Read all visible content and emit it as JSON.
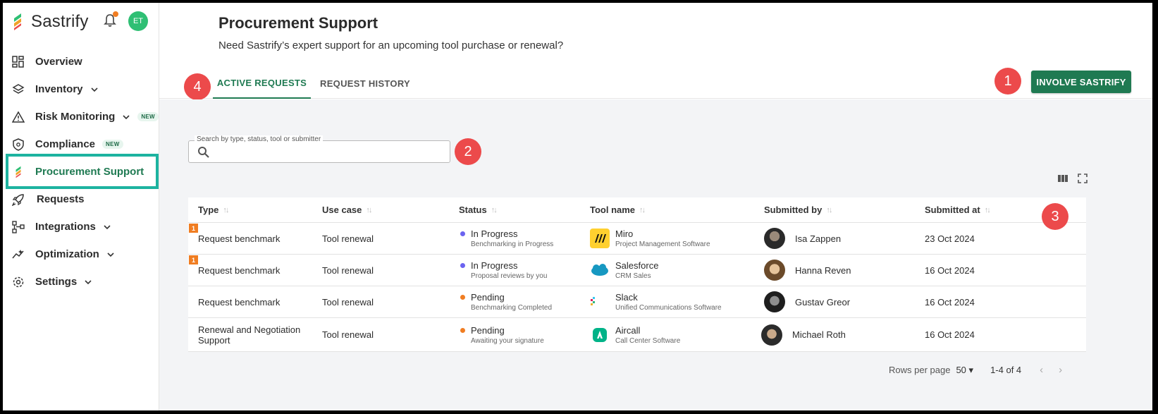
{
  "app": {
    "brand": "Sastrify",
    "user_initials": "ET"
  },
  "sidebar": {
    "items": [
      {
        "label": "Overview"
      },
      {
        "label": "Inventory"
      },
      {
        "label": "Risk Monitoring",
        "badge": "NEW"
      },
      {
        "label": "Compliance",
        "badge": "NEW"
      },
      {
        "label": "Procurement Support"
      },
      {
        "label": "Requests"
      },
      {
        "label": "Integrations"
      },
      {
        "label": "Optimization"
      },
      {
        "label": "Settings"
      }
    ]
  },
  "header": {
    "title": "Procurement Support",
    "subtitle": "Need Sastrify’s expert support for an upcoming tool purchase or renewal?"
  },
  "tabs": [
    {
      "label": "ACTIVE REQUESTS"
    },
    {
      "label": "REQUEST HISTORY"
    }
  ],
  "actions": {
    "involve_label": "INVOLVE SASTRIFY"
  },
  "markers": {
    "m1": "1",
    "m2": "2",
    "m3": "3",
    "m4": "4"
  },
  "search": {
    "label": "Search by type, status, tool or submitter",
    "value": ""
  },
  "table": {
    "headers": {
      "type": "Type",
      "use_case": "Use case",
      "status": "Status",
      "tool": "Tool name",
      "submitted_by": "Submitted by",
      "submitted_at": "Submitted at"
    },
    "rows": [
      {
        "flag": "1",
        "type": "Request benchmark",
        "use_case": "Tool renewal",
        "status": "In Progress",
        "status_sub": "Benchmarking in Progress",
        "tool": "Miro",
        "tool_cat": "Project Management Software",
        "submitter": "Isa Zappen",
        "date": "23 Oct 2024"
      },
      {
        "flag": "1",
        "type": "Request benchmark",
        "use_case": "Tool renewal",
        "status": "In Progress",
        "status_sub": "Proposal reviews by you",
        "tool": "Salesforce",
        "tool_cat": "CRM Sales",
        "submitter": "Hanna Reven",
        "date": "16 Oct 2024"
      },
      {
        "type": "Request benchmark",
        "use_case": "Tool renewal",
        "status": "Pending",
        "status_sub": "Benchmarking Completed",
        "tool": "Slack",
        "tool_cat": "Unified Communications Software",
        "submitter": "Gustav Greor",
        "date": "16 Oct 2024"
      },
      {
        "type": "Renewal and Negotiation Support",
        "use_case": "Tool renewal",
        "status": "Pending",
        "status_sub": "Awaiting your signature",
        "tool": "Aircall",
        "tool_cat": "Call Center Software",
        "submitter": "Michael Roth",
        "date": "16 Oct 2024"
      }
    ]
  },
  "pager": {
    "rows_label": "Rows per page",
    "rows_value": "50",
    "range": "1-4 of 4"
  },
  "colors": {
    "brand_green": "#1f7a52",
    "marker_red": "#ec4a4b",
    "in_progress": "#6b63f0",
    "pending": "#f07d22",
    "highlight": "#1db3a0"
  },
  "icons": [
    "bell-icon",
    "overview-icon",
    "layers-icon",
    "warning-icon",
    "shield-icon",
    "rocket-icon",
    "integrations-icon",
    "optimization-icon",
    "gear-icon",
    "search-icon",
    "columns-icon",
    "fullscreen-icon"
  ]
}
